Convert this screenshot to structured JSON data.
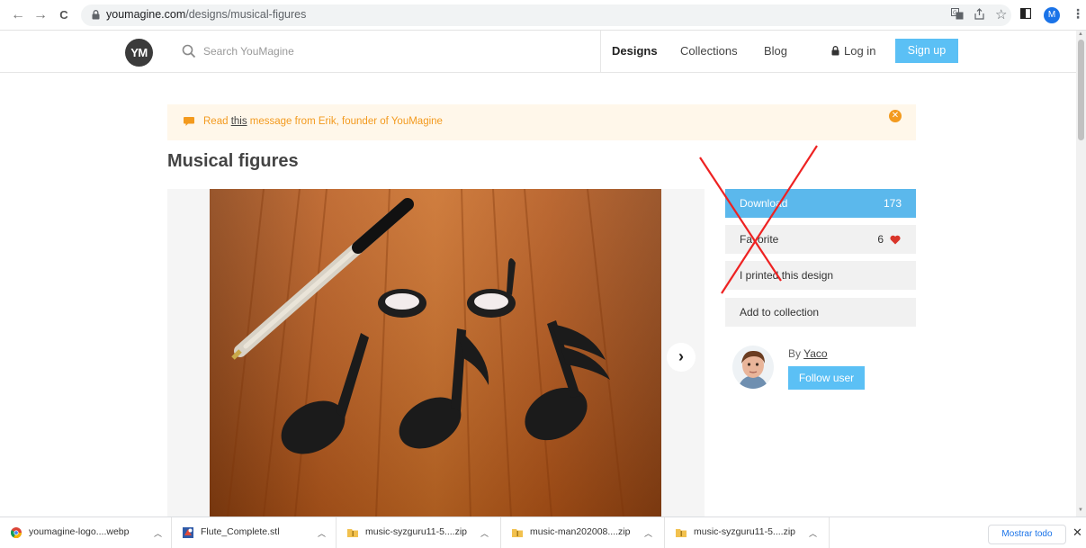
{
  "browser": {
    "back": "←",
    "forward": "→",
    "reload": "C",
    "url_host": "youmagine.com",
    "url_path": "/designs/musical-figures",
    "profile_initial": "M"
  },
  "header": {
    "logo": "YM",
    "search_placeholder": "Search YouMagine",
    "nav": [
      "Designs",
      "Collections",
      "Blog"
    ],
    "login": "Log in",
    "signup": "Sign up"
  },
  "banner": {
    "before": "Read ",
    "link": "this",
    "after": " message from Erik, founder of YouMagine"
  },
  "design": {
    "title": "Musical figures"
  },
  "actions": {
    "download": "Download",
    "download_count": "173",
    "favorite": "Favorite",
    "favorite_count": "6",
    "printed": "I printed this design",
    "collection": "Add to collection"
  },
  "author": {
    "by": "By ",
    "name": "Yaco",
    "follow": "Follow user"
  },
  "downloads": [
    {
      "name": "youmagine-logo....webp",
      "icon": "chrome-icon"
    },
    {
      "name": "Flute_Complete.stl",
      "icon": "stl-icon"
    },
    {
      "name": "music-syzguru11-5....zip",
      "icon": "zip-folder-icon"
    },
    {
      "name": "music-man202008....zip",
      "icon": "zip-folder-icon"
    },
    {
      "name": "music-syzguru11-5....zip",
      "icon": "zip-folder-icon"
    }
  ],
  "shelf": {
    "show_all": "Mostrar todo",
    "close": "✕"
  },
  "colors": {
    "accent_blue": "#5bc0f5",
    "banner_orange": "#f39a1e",
    "heart_red": "#d9352a",
    "overlay_red": "#e22"
  }
}
